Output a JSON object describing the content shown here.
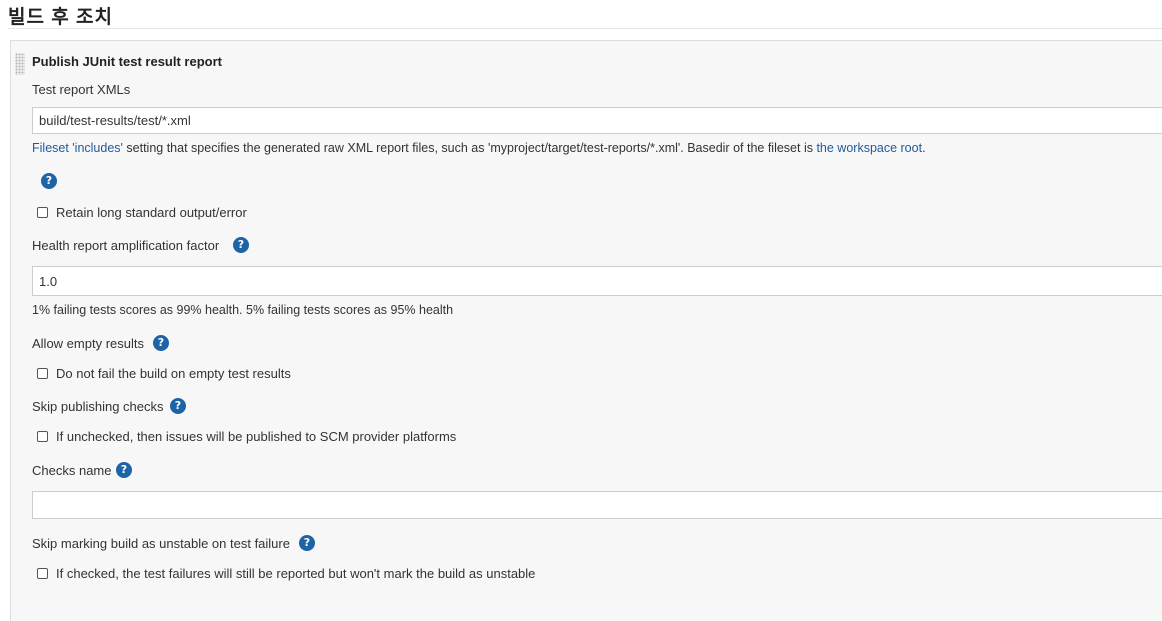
{
  "section": {
    "title": "빌드 후 조치"
  },
  "publisher": {
    "title": "Publish JUnit test result report",
    "test_report_label": "Test report XMLs",
    "test_report_value": "build/test-results/test/*.xml",
    "desc_fileset_link": "Fileset 'includes'",
    "desc_middle": " setting that specifies the generated raw XML report files, such as 'myproject/target/test-reports/*.xml'. Basedir of the fileset is ",
    "desc_workspace_link": "the workspace root",
    "desc_end": ".",
    "retain_label": "Retain long standard output/error",
    "health_label": "Health report amplification factor",
    "health_value": "1.0",
    "health_desc": "1% failing tests scores as 99% health. 5% failing tests scores as 95% health",
    "allow_empty_label": "Allow empty results",
    "allow_empty_checkbox": "Do not fail the build on empty test results",
    "skip_publishing_label": "Skip publishing checks",
    "skip_publishing_checkbox": "If unchecked, then issues will be published to SCM provider platforms",
    "checks_name_label": "Checks name",
    "checks_name_value": "",
    "skip_marking_label": "Skip marking build as unstable on test failure",
    "skip_marking_checkbox": "If checked, the test failures will still be reported but won't mark the build as unstable"
  },
  "help_glyph": "?",
  "icons": {
    "help": "help-icon",
    "drag": "drag-handle-icon"
  },
  "colors": {
    "help_icon": "#1e63a6",
    "link": "#1f5b9b",
    "panel_bg": "#f7f7f7"
  }
}
